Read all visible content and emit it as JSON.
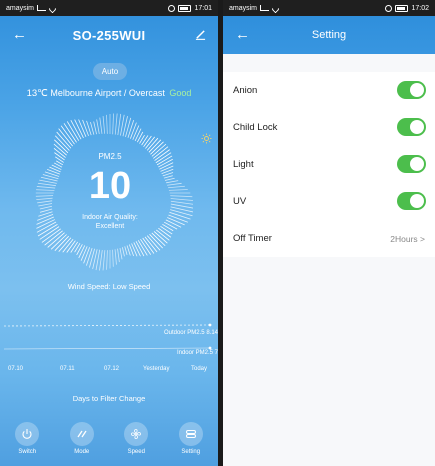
{
  "left": {
    "status_bar": {
      "carrier": "amaysim",
      "time": "17:01"
    },
    "title": "SO-255WUI",
    "mode_badge": "Auto",
    "weather": {
      "temperature": "13℃",
      "location": "Melbourne Airport / Overcast",
      "quality": "Good"
    },
    "gauge": {
      "label": "PM2.5",
      "value": "10",
      "quality_line1": "Indoor Air Quality:",
      "quality_line2": "Excellent"
    },
    "wind_speed": "Wind Speed: Low Speed",
    "chart_data": {
      "type": "line",
      "categories": [
        "07.10",
        "07.11",
        "07.12",
        "Yesterday",
        "Today"
      ],
      "series": [
        {
          "name": "Outdoor PM2.5",
          "last_value_label": "8.14"
        },
        {
          "name": "Indoor PM2.5",
          "last_value_label": "7"
        }
      ]
    },
    "filter_text": "Days to Filter Change",
    "bottom_nav": [
      {
        "label": "Switch",
        "icon": "power-icon"
      },
      {
        "label": "Mode",
        "icon": "mode-icon"
      },
      {
        "label": "Speed",
        "icon": "fan-icon"
      },
      {
        "label": "Setting",
        "icon": "setting-icon"
      }
    ]
  },
  "right": {
    "status_bar": {
      "carrier": "amaysim",
      "time": "17:02"
    },
    "title": "Setting",
    "settings": [
      {
        "label": "Anion",
        "type": "toggle",
        "on": true
      },
      {
        "label": "Child Lock",
        "type": "toggle",
        "on": true
      },
      {
        "label": "Light",
        "type": "toggle",
        "on": true
      },
      {
        "label": "UV",
        "type": "toggle",
        "on": true
      },
      {
        "label": "Off Timer",
        "type": "value",
        "value": "2Hours",
        "chevron": ">"
      }
    ]
  },
  "colors": {
    "primary_blue": "#2f8fdc",
    "toggle_green": "#4cbe4c"
  }
}
